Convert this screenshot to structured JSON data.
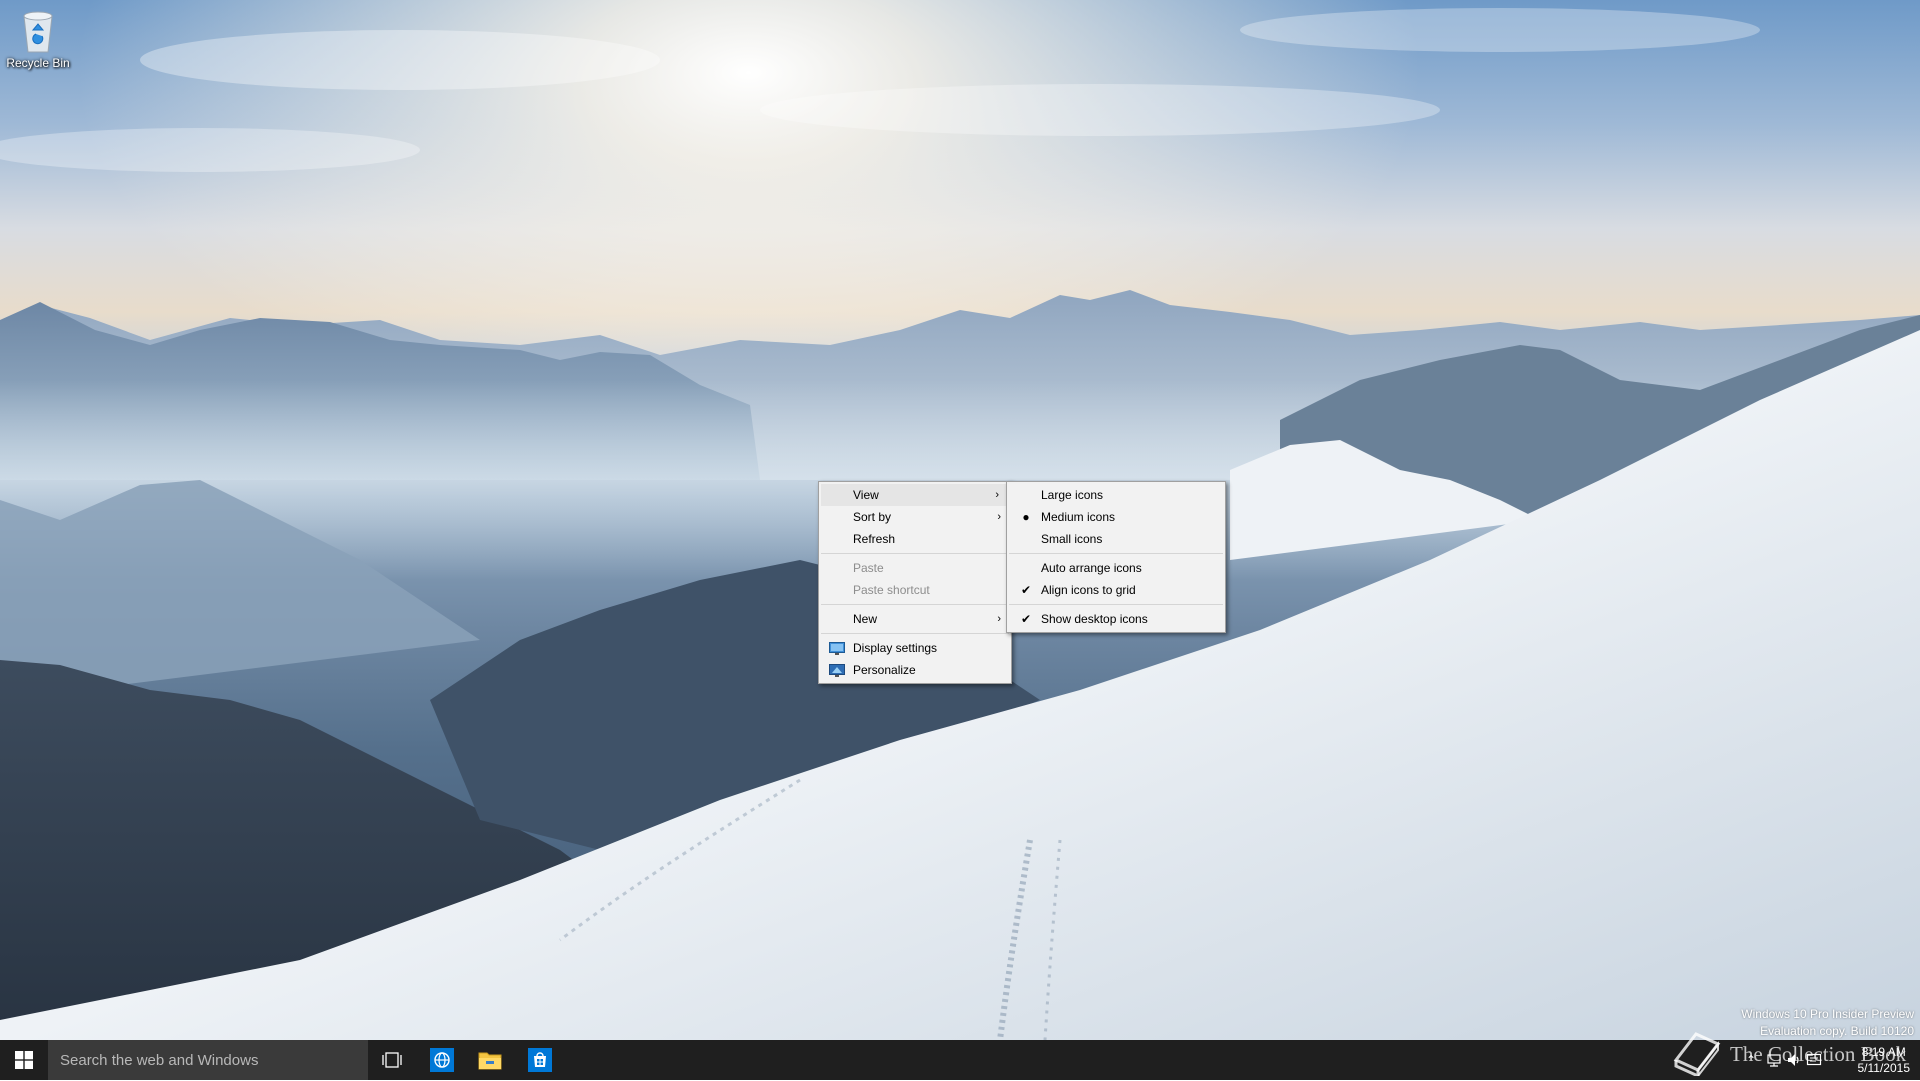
{
  "desktop": {
    "icons": [
      {
        "label": "Recycle Bin",
        "icon": "recycle-bin-icon"
      }
    ]
  },
  "context_menu": {
    "items": [
      {
        "label": "View",
        "has_submenu": true,
        "highlighted": true
      },
      {
        "label": "Sort by",
        "has_submenu": true
      },
      {
        "label": "Refresh"
      },
      {
        "label": "Paste",
        "disabled": true
      },
      {
        "label": "Paste shortcut",
        "disabled": true
      },
      {
        "label": "New",
        "has_submenu": true
      },
      {
        "label": "Display settings",
        "icon": "display-settings-icon"
      },
      {
        "label": "Personalize",
        "icon": "personalize-icon"
      }
    ]
  },
  "view_submenu": {
    "items": [
      {
        "label": "Large icons"
      },
      {
        "label": "Medium icons",
        "mark": "bullet"
      },
      {
        "label": "Small icons"
      },
      {
        "label": "Auto arrange icons"
      },
      {
        "label": "Align icons to grid",
        "mark": "check"
      },
      {
        "label": "Show desktop icons",
        "mark": "check"
      }
    ],
    "marks": {
      "bullet": "●",
      "check": "✔"
    }
  },
  "watermark": {
    "line1": "Windows 10 Pro Insider Preview",
    "line2": "Evaluation copy. Build 10120"
  },
  "taskbar": {
    "search_placeholder": "Search the web and Windows",
    "pinned": [
      {
        "name": "task-view",
        "icon": "task-view-icon"
      },
      {
        "name": "edge",
        "icon": "browser-icon"
      },
      {
        "name": "file-explorer",
        "icon": "folder-icon"
      },
      {
        "name": "store",
        "icon": "store-icon"
      }
    ],
    "clock": {
      "time": "8:19 AM",
      "date": "5/11/2015"
    },
    "brand": "The Collection Book"
  },
  "colors": {
    "taskbar_bg": "#1f1f1f",
    "search_bg": "#3a3a3a",
    "menu_bg": "#f2f2f2",
    "menu_highlight": "#e5e5e5",
    "accent": "#0078d7"
  }
}
